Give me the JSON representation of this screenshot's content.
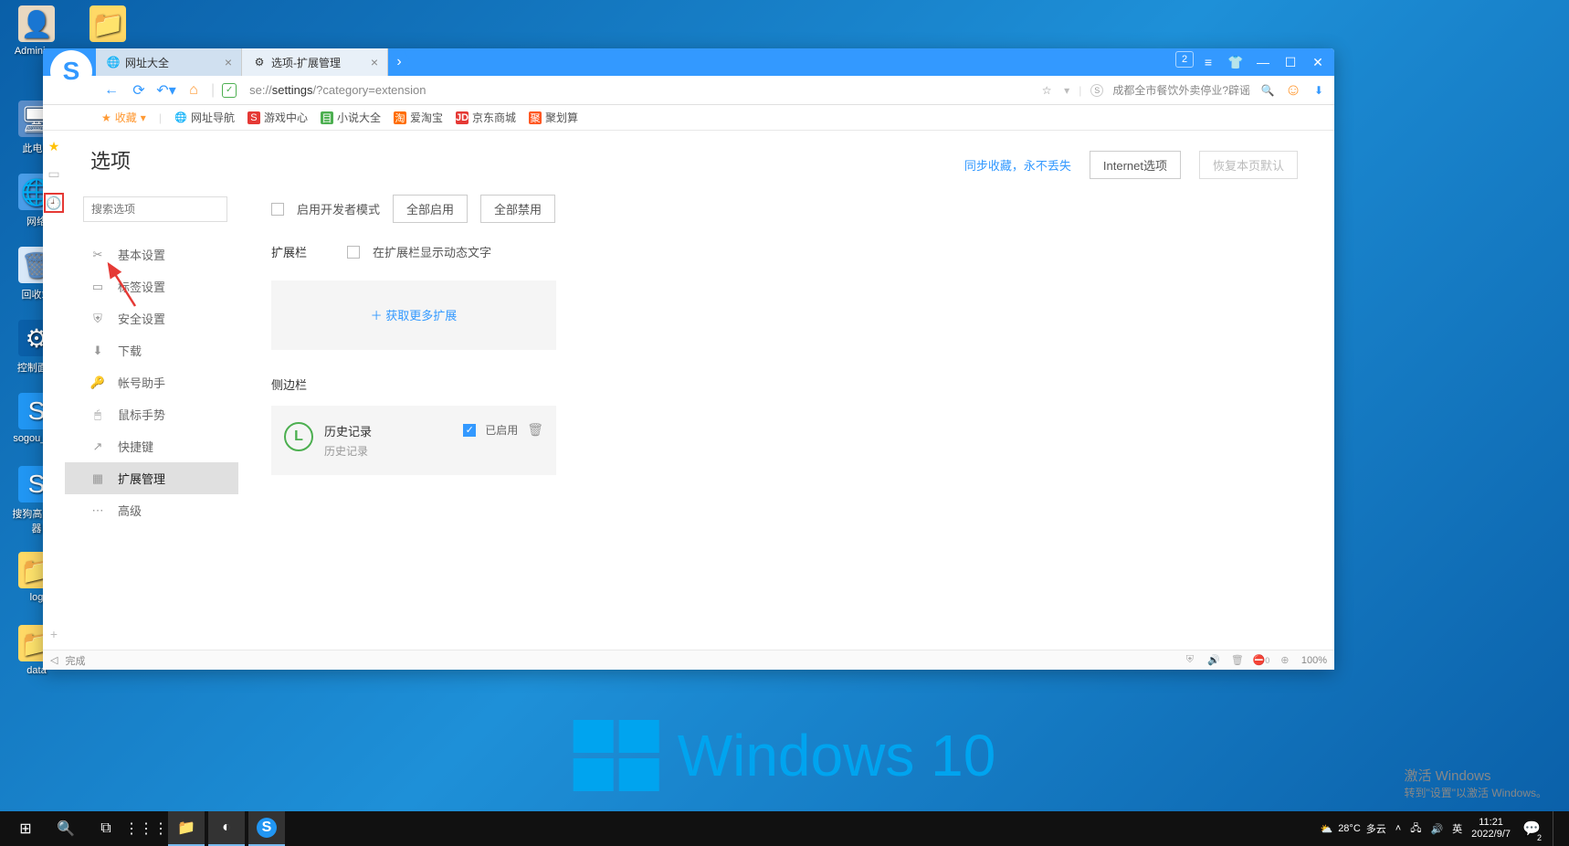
{
  "desktop": {
    "icons": [
      {
        "label": "Adminis..."
      },
      {
        "label": "此电..."
      },
      {
        "label": "网络"
      },
      {
        "label": "回收站"
      },
      {
        "label": "控制面..."
      },
      {
        "label": "sogou_e..."
      },
      {
        "label": "搜狗高速...\n器"
      },
      {
        "label": "log"
      },
      {
        "label": "data"
      }
    ],
    "icon_folder": {
      "label": ""
    }
  },
  "browser": {
    "tabs": [
      {
        "title": "网址大全"
      },
      {
        "title": "选项-扩展管理"
      }
    ],
    "window_badge": "2",
    "nav": {
      "url_prefix": "se://",
      "url_bold": "settings",
      "url_suffix": "/?category=extension",
      "search_hint": "成都全市餐饮外卖停业?辟谣"
    },
    "bookmarks": {
      "fav": "收藏",
      "items": [
        {
          "label": "网址导航"
        },
        {
          "label": "游戏中心"
        },
        {
          "label": "小说大全"
        },
        {
          "label": "爱淘宝"
        },
        {
          "label": "京东商城"
        },
        {
          "label": "聚划算"
        }
      ]
    },
    "statusbar": {
      "left_arrow": "◁",
      "status_text": "完成",
      "zoom": "100%",
      "shield_badge": "0"
    }
  },
  "settings": {
    "title": "选项",
    "search_placeholder": "搜索选项",
    "top_links": {
      "sync": "同步收藏，永不丢失",
      "internet": "Internet选项",
      "restore": "恢复本页默认"
    },
    "menu": [
      {
        "label": "基本设置"
      },
      {
        "label": "标签设置"
      },
      {
        "label": "安全设置"
      },
      {
        "label": "下载"
      },
      {
        "label": "帐号助手"
      },
      {
        "label": "鼠标手势"
      },
      {
        "label": "快捷键"
      },
      {
        "label": "扩展管理"
      },
      {
        "label": "高级"
      }
    ],
    "dev_mode": "启用开发者模式",
    "enable_all": "全部启用",
    "disable_all": "全部禁用",
    "ext_bar_label": "扩展栏",
    "show_text": "在扩展栏显示动态文字",
    "get_more": "获取更多扩展",
    "sidebar_label": "侧边栏",
    "history_ext": {
      "name": "历史记录",
      "desc": "历史记录",
      "enabled": "已启用"
    }
  },
  "windows": {
    "brand": "Windows 10",
    "activate_title": "激活 Windows",
    "activate_sub": "转到\"设置\"以激活 Windows。"
  },
  "taskbar": {
    "weather_temp": "28°C",
    "weather_text": "多云",
    "ime": "英",
    "time": "11:21",
    "date": "2022/9/7",
    "notif_badge": "2"
  }
}
